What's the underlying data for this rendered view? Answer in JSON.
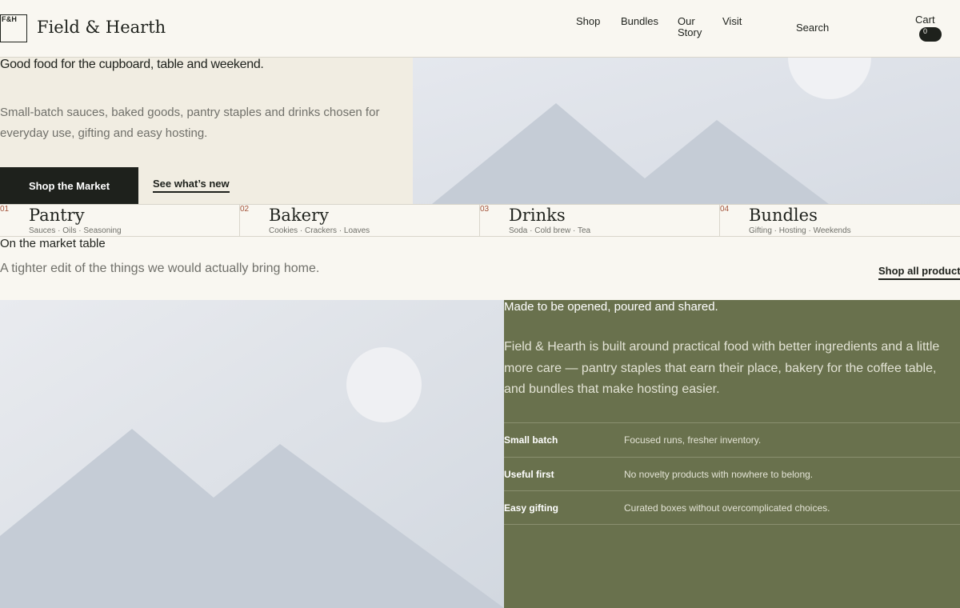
{
  "header": {
    "logo_mark": "F&H",
    "brand": "Field & Hearth",
    "nav": [
      "Shop",
      "Bundles",
      "Our Story",
      "Visit"
    ],
    "search_label": "Search",
    "cart_label": "Cart",
    "cart_count": "0"
  },
  "hero": {
    "title": "Good food for the cupboard, table and weekend.",
    "body": "Small-batch sauces, baked goods, pantry staples and drinks chosen for everyday use, gifting and easy hosting.",
    "primary_cta": "Shop the Market",
    "secondary_cta": "See what’s new"
  },
  "categories": [
    {
      "num": "01",
      "title": "Pantry",
      "sub": "Sauces · Oils · Seasoning"
    },
    {
      "num": "02",
      "title": "Bakery",
      "sub": "Cookies · Crackers · Loaves"
    },
    {
      "num": "03",
      "title": "Drinks",
      "sub": "Soda · Cold brew · Tea"
    },
    {
      "num": "04",
      "title": "Bundles",
      "sub": "Gifting · Hosting · Weekends"
    }
  ],
  "market": {
    "title": "On the market table",
    "body": "A tighter edit of the things we would actually bring home.",
    "link": "Shop all products"
  },
  "story": {
    "title": "Made to be opened, poured and shared.",
    "body": "Field & Hearth is built around practical food with better ingredients and a little more care — pantry staples that earn their place, bakery for the coffee table, and bundles that make hosting easier.",
    "features": [
      {
        "name": "Small batch",
        "desc": "Focused runs, fresher inventory."
      },
      {
        "name": "Useful first",
        "desc": "No novelty products with nowhere to belong."
      },
      {
        "name": "Easy gifting",
        "desc": "Curated boxes without overcomplicated choices."
      }
    ]
  },
  "colors": {
    "dark": "#1e211c",
    "cream": "#f9f7f1",
    "hero_panel": "#f1ede2",
    "olive": "#69714d",
    "accent_number": "#a3533a",
    "muted_text": "#70706a"
  },
  "icons": [
    "image-placeholder-icon"
  ]
}
